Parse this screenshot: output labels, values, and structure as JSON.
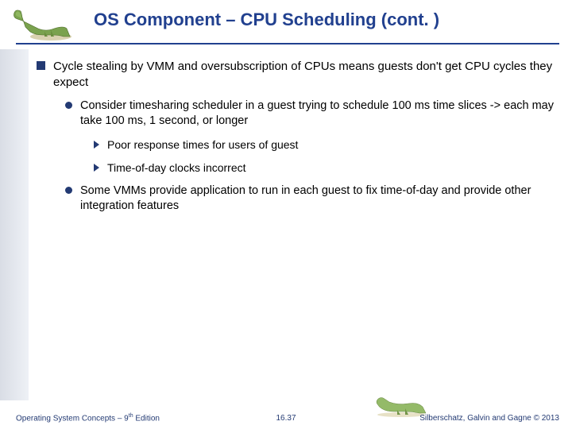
{
  "slide": {
    "title": "OS Component – CPU Scheduling (cont. )",
    "bullets": {
      "b1": "Cycle stealing by VMM and oversubscription of CPUs means guests don't get CPU cycles they expect",
      "b1_1": "Consider timesharing scheduler in a guest trying to schedule 100 ms time slices -> each may take 100 ms, 1 second, or longer",
      "b1_1_1": "Poor response times for users of guest",
      "b1_1_2": "Time-of-day clocks incorrect",
      "b1_2": "Some VMMs provide application to run in each guest to fix time-of-day and provide other integration features"
    }
  },
  "footer": {
    "left_prefix": "Operating System Concepts – 9",
    "left_suffix": " Edition",
    "left_sup": "th",
    "center": "16.37",
    "right": "Silberschatz, Galvin and Gagne © 2013"
  }
}
